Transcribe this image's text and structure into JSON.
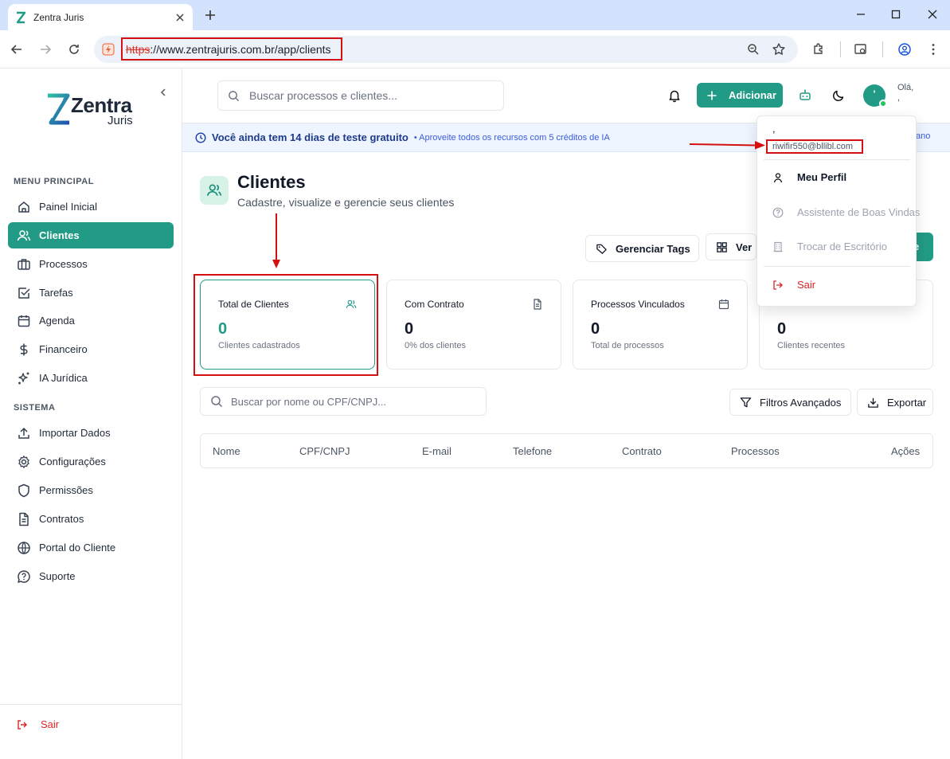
{
  "browser": {
    "tab_title": "Zentra Juris",
    "url_scheme": "https",
    "url_rest": "://www.zentrajuris.com.br/app/clients"
  },
  "sidebar": {
    "logo_word1": "Zentra",
    "logo_word2": "Juris",
    "section_main": "MENU PRINCIPAL",
    "section_system": "SISTEMA",
    "items": [
      {
        "label": "Painel Inicial",
        "icon": "home-icon"
      },
      {
        "label": "Clientes",
        "icon": "users-icon",
        "active": true
      },
      {
        "label": "Processos",
        "icon": "briefcase-icon"
      },
      {
        "label": "Tarefas",
        "icon": "checkbox-icon"
      },
      {
        "label": "Agenda",
        "icon": "calendar-icon"
      },
      {
        "label": "Financeiro",
        "icon": "dollar-icon"
      },
      {
        "label": "IA Jurídica",
        "icon": "sparkles-icon"
      }
    ],
    "system_items": [
      {
        "label": "Importar Dados",
        "icon": "upload-icon"
      },
      {
        "label": "Configurações",
        "icon": "gear-icon"
      },
      {
        "label": "Permissões",
        "icon": "shield-icon"
      },
      {
        "label": "Contratos",
        "icon": "file-icon"
      },
      {
        "label": "Portal do Cliente",
        "icon": "globe-icon"
      },
      {
        "label": "Suporte",
        "icon": "help-icon"
      }
    ],
    "logout": "Sair"
  },
  "header": {
    "search_placeholder": "Buscar processos e clientes...",
    "add_label": "Adicionar",
    "avatar_initial": "'",
    "hello": "Olá,",
    "hello_name": ","
  },
  "trial": {
    "main": "Você ainda tem 14 dias de teste gratuito",
    "detail": "• Aproveite todos os recursos com 5 créditos de IA",
    "right": "ano"
  },
  "page": {
    "title": "Clientes",
    "subtitle": "Cadastre, visualize e gerencie seus clientes"
  },
  "actions": {
    "manage_tags": "Gerenciar Tags",
    "view": "Ver",
    "new_partial": "e"
  },
  "stats": [
    {
      "label": "Total de Clientes",
      "value": "0",
      "sub": "Clientes cadastrados",
      "icon": "users-icon"
    },
    {
      "label": "Com Contrato",
      "value": "0",
      "sub": "0% dos clientes",
      "icon": "document-icon"
    },
    {
      "label": "Processos Vinculados",
      "value": "0",
      "sub": "Total de processos",
      "icon": "calendar-icon"
    },
    {
      "label": "",
      "value": "0",
      "sub": "Clientes recentes",
      "icon": ""
    }
  ],
  "table": {
    "search_placeholder": "Buscar por nome ou CPF/CNPJ...",
    "advanced_filters": "Filtros Avançados",
    "export": "Exportar",
    "columns": [
      "Nome",
      "CPF/CNPJ",
      "E-mail",
      "Telefone",
      "Contrato",
      "Processos",
      "Ações"
    ]
  },
  "dropdown": {
    "name": ",",
    "email": "riwifir550@bllibl.com",
    "profile": "Meu Perfil",
    "assistant": "Assistente de Boas Vindas",
    "office": "Trocar de Escritório",
    "logout": "Sair"
  },
  "colors": {
    "accent": "#229b86",
    "danger": "#dc2626",
    "annotation": "#d41010"
  }
}
